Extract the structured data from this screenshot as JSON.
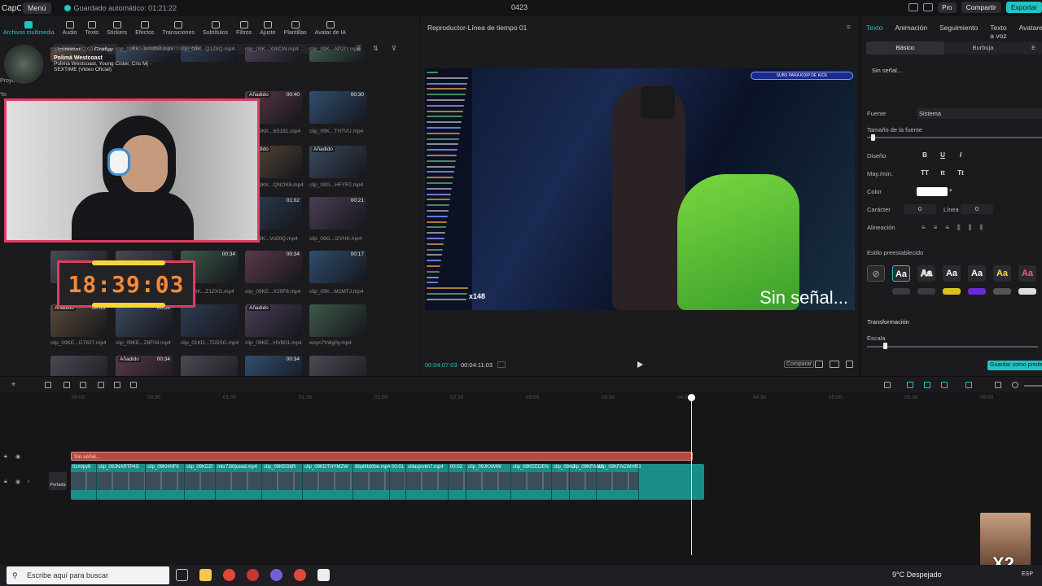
{
  "app": {
    "logo": "CapCut",
    "menu": "Menú",
    "autosave": "Guardado automático: 01:21:22",
    "project": "0423",
    "pro": "Pro",
    "share": "Compartir",
    "export": "Exportar"
  },
  "toolbar": {
    "tools": [
      "Archivos multimedia",
      "Audio",
      "Texto",
      "Stickers",
      "Efectos",
      "Transiciones",
      "Subtítulos",
      "Filtros",
      "Ajuste",
      "Plantillas",
      "Avatar de IA"
    ]
  },
  "media": {
    "import": "Importar",
    "record": "Grabar",
    "search_placeholder": "Buscar archivos multimedia",
    "side_label": "Proyecto",
    "side_label2": "Yo",
    "song_title": "Polimá Westcoast",
    "song_sub": "Polimá Westcoast, Young Cister, Cris Mj - SEXTIME (Video Oficial)",
    "clips": [
      {
        "name": "clip_09KK...1QXD7.mp4",
        "dur": ""
      },
      {
        "name": "clip_09KK...N4M9B.mp4",
        "dur": ""
      },
      {
        "name": "clip_09K...Q1Z8Q.mp4",
        "dur": ""
      },
      {
        "name": "clip_09K...XWCW.mp4",
        "dur": ""
      },
      {
        "name": "clip_09K...AP2IY.mp4",
        "dur": ""
      },
      {
        "name": "clip_09KK...6S181.mp4",
        "dur": "00:40",
        "added": "Añadido"
      },
      {
        "name": "clip_09K...TH7VU.mp4",
        "dur": "00:30"
      },
      {
        "name": "clip_09KK...QNOK6.mp4",
        "dur": "",
        "added": "Añadido"
      },
      {
        "name": "clip_09G...HFYF0.mp4",
        "dur": "",
        "added": "Añadido"
      },
      {
        "name": "clip_09K...Vo50Q.mp4",
        "dur": "01:02"
      },
      {
        "name": "clip_09G...I2VHK.mp4",
        "dur": "00:21"
      },
      {
        "name": "clip_09K...Z1ZXG.mp4",
        "dur": "00:34"
      },
      {
        "name": "clip_09KE...X29F6.mp4",
        "dur": "00:34"
      },
      {
        "name": "clip_09K...M2MTJ.mp4",
        "dur": "00:17"
      },
      {
        "name": "clip_09KE...G7827.mp4",
        "dur": "00:55",
        "added": "Añadido"
      },
      {
        "name": "clip_09KE...Z8F04.mp4",
        "dur": "00:34"
      },
      {
        "name": "clip_01KD...TD5SG.mp4",
        "dur": ""
      },
      {
        "name": "clip_09KE...HVB01.mp4",
        "dur": "",
        "added": "Añadido"
      },
      {
        "name": "wsyn7fn6g0y.mp4",
        "dur": ""
      },
      {
        "name": "",
        "dur": "00:34",
        "added": "Añadido"
      },
      {
        "name": "",
        "dur": "00:34"
      }
    ]
  },
  "overlay": {
    "timer": "18:39:03",
    "x148": "x148",
    "x2": "X2"
  },
  "player": {
    "title": "Reproductor-Línea de tiempo 01",
    "subs_banner": "SUBS PARA KOIP DE KICK",
    "no_signal": "Sin señal...",
    "current_time": "00:04:07:03",
    "total_time": "00:04:11:03",
    "compare": "Comparar"
  },
  "props": {
    "tabs": [
      "Texto",
      "Animación",
      "Seguimiento",
      "Texto a voz",
      "Avatares"
    ],
    "subtabs": [
      "Básico",
      "Burbuja",
      "E"
    ],
    "text_value": "Sin señal...",
    "font_label": "Fuente",
    "font_value": "Sistema",
    "size_label": "Tamaño de la fuente",
    "design_label": "Diseño",
    "design_btns": [
      "B",
      "U",
      "I"
    ],
    "case_label": "May./min.",
    "case_btns": [
      "TT",
      "tt",
      "Tt"
    ],
    "color_label": "Color",
    "char_label": "Carácter",
    "char_value": "0",
    "line_label": "Línea",
    "line_value": "0",
    "align_label": "Alineación",
    "preset_label": "Estilo preestablecido",
    "presets": [
      "Aa",
      "Aa",
      "Aa",
      "Aa",
      "Aa",
      "Aa"
    ],
    "transform_label": "Transformación",
    "scale_label": "Escala",
    "save_preset": "Guardar como predeterminado"
  },
  "timeline": {
    "ticks": [
      "00:00",
      "00:30",
      "01:00",
      "01:30",
      "02:00",
      "02:30",
      "03:00",
      "03:30",
      "04:00",
      "04:30",
      "05:00",
      "05:30",
      "06:00"
    ],
    "text_clip": "Sin señal...",
    "cover": "Portada",
    "clips": [
      "0zmipy6",
      "clip_09JNARTP4S",
      "ciip_09KHHF6",
      "clip_09KDZI",
      "mkr73i0jcead.mp4",
      "clip_09KEG6R",
      "clip_09KDTHYMZW",
      "9bplfrbt0be.mp4",
      "00:01",
      "villasjvvkh7.mp4",
      "00:02",
      "clip_09JKXMW",
      "clip_09KEEDEN",
      "clip_09KJ",
      "clip_09KFAMX",
      "clip_09KFACWHR3"
    ]
  },
  "taskbar": {
    "search": "Escribe aquí para buscar",
    "weather": "9°C Despejado",
    "lang": "ESP"
  }
}
